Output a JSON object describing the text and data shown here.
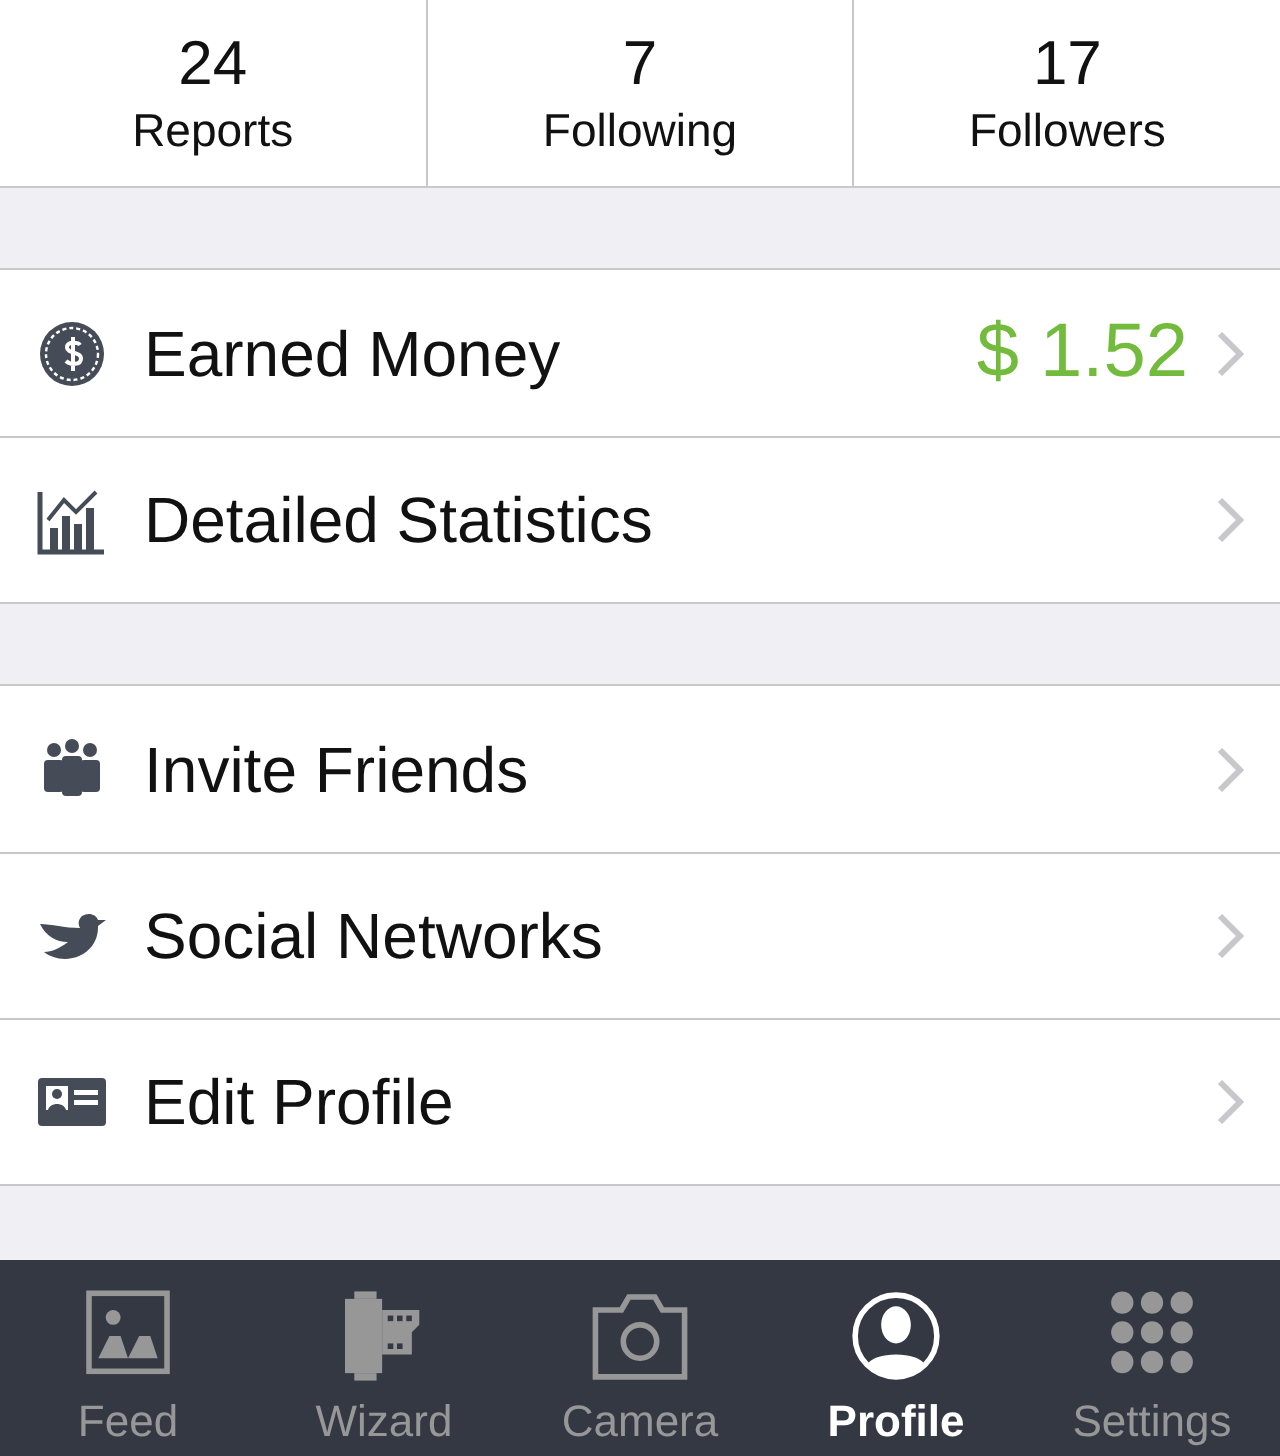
{
  "stats": [
    {
      "count": "24",
      "label": "Reports"
    },
    {
      "count": "7",
      "label": "Following"
    },
    {
      "count": "17",
      "label": "Followers"
    }
  ],
  "groups": [
    {
      "items": [
        {
          "label": "Earned Money",
          "value": "$ 1.52"
        },
        {
          "label": "Detailed Statistics"
        }
      ]
    },
    {
      "items": [
        {
          "label": "Invite Friends"
        },
        {
          "label": "Social Networks"
        },
        {
          "label": "Edit Profile"
        }
      ]
    }
  ],
  "tab_bar": [
    {
      "label": "Feed",
      "selected": false
    },
    {
      "label": "Wizard",
      "selected": false
    },
    {
      "label": "Camera",
      "selected": false
    },
    {
      "label": "Profile",
      "selected": true
    },
    {
      "label": "Settings",
      "selected": false
    }
  ]
}
